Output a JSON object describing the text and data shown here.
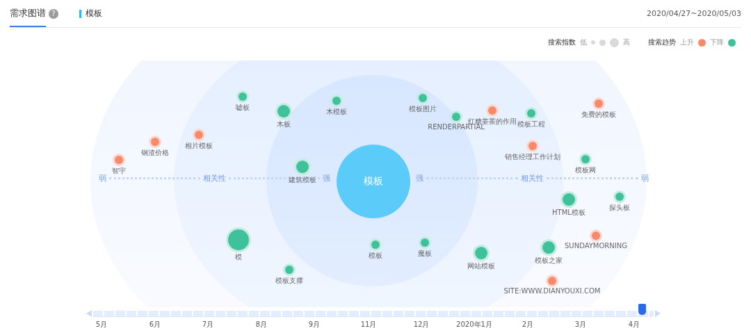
{
  "tabs": [
    {
      "label": "需求图谱",
      "selected": true
    }
  ],
  "help": "?",
  "keyword": "模板",
  "date_range": "2020/04/27~2020/05/03",
  "legend": {
    "index_title": "搜索指数",
    "low": "低",
    "high": "高",
    "trend_title": "搜索趋势",
    "up": "上升",
    "down": "下降"
  },
  "graph": {
    "center": "模板",
    "axis_left": [
      "弱",
      "相关性",
      "强"
    ],
    "axis_right": [
      "强",
      "相关性",
      "弱"
    ],
    "nodes": [
      {
        "label": "嘘板",
        "color": "#3fc19b",
        "kind": "small"
      },
      {
        "label": "木板",
        "color": "#3fc19b",
        "kind": "medium"
      },
      {
        "label": "木模板",
        "color": "#3fc19b",
        "kind": "small"
      },
      {
        "label": "模板图片",
        "color": "#3fc19b",
        "kind": "small"
      },
      {
        "label": "RENDERPARTIAL",
        "color": "#3fc19b",
        "kind": "small"
      },
      {
        "label": "红糖姜茶的作用",
        "color": "#f88a6c",
        "kind": "small"
      },
      {
        "label": "模板工程",
        "color": "#3fc19b",
        "kind": "small"
      },
      {
        "label": "免费的模板",
        "color": "#f88a6c",
        "kind": "small"
      },
      {
        "label": "钢渣价格",
        "color": "#f88a6c",
        "kind": "small"
      },
      {
        "label": "相片模板",
        "color": "#f88a6c",
        "kind": "small"
      },
      {
        "label": "智宇",
        "color": "#f88a6c",
        "kind": "small"
      },
      {
        "label": "建筑模板",
        "color": "#3fc19b",
        "kind": "medium"
      },
      {
        "label": "销售经理工作计划",
        "color": "#f88a6c",
        "kind": "small"
      },
      {
        "label": "模板网",
        "color": "#3fc19b",
        "kind": "small"
      },
      {
        "label": "HTML模板",
        "color": "#3fc19b",
        "kind": "medium"
      },
      {
        "label": "探头板",
        "color": "#3fc19b",
        "kind": "small"
      },
      {
        "label": "模",
        "color": "#3fc19b",
        "kind": "large"
      },
      {
        "label": "模板",
        "color": "#3fc19b",
        "kind": "small"
      },
      {
        "label": "魔板",
        "color": "#3fc19b",
        "kind": "small"
      },
      {
        "label": "网站模板",
        "color": "#3fc19b",
        "kind": "medium"
      },
      {
        "label": "模板之家",
        "color": "#3fc19b",
        "kind": "medium"
      },
      {
        "label": "SUNDAYMORNING",
        "color": "#f88a6c",
        "kind": "small"
      },
      {
        "label": "模板支撑",
        "color": "#3fc19b",
        "kind": "small"
      },
      {
        "label": "SITE:WWW.DIANYOUXI.COM",
        "color": "#f88a6c",
        "kind": "small"
      }
    ]
  },
  "timeline": {
    "months": [
      "5月",
      "6月",
      "7月",
      "8月",
      "9月",
      "11月",
      "12月",
      "2020年1月",
      "2月",
      "3月",
      "4月"
    ],
    "level": 0.98
  }
}
